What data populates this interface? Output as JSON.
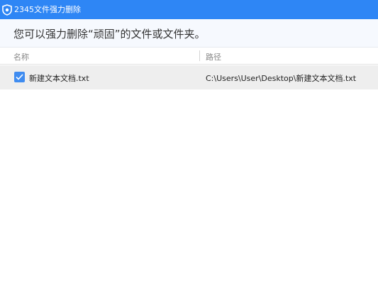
{
  "window": {
    "title": "2345文件强力删除",
    "icon": "shield-icon",
    "accent_color": "#2e86f5"
  },
  "notice": {
    "text": "您可以强力删除“顽固”的文件或文件夹。"
  },
  "table": {
    "columns": [
      "名称",
      "路径"
    ],
    "rows": [
      {
        "checked": true,
        "name": "新建文本文档.txt",
        "path": "C:\\Users\\User\\Desktop\\新建文本文档.txt"
      }
    ]
  }
}
